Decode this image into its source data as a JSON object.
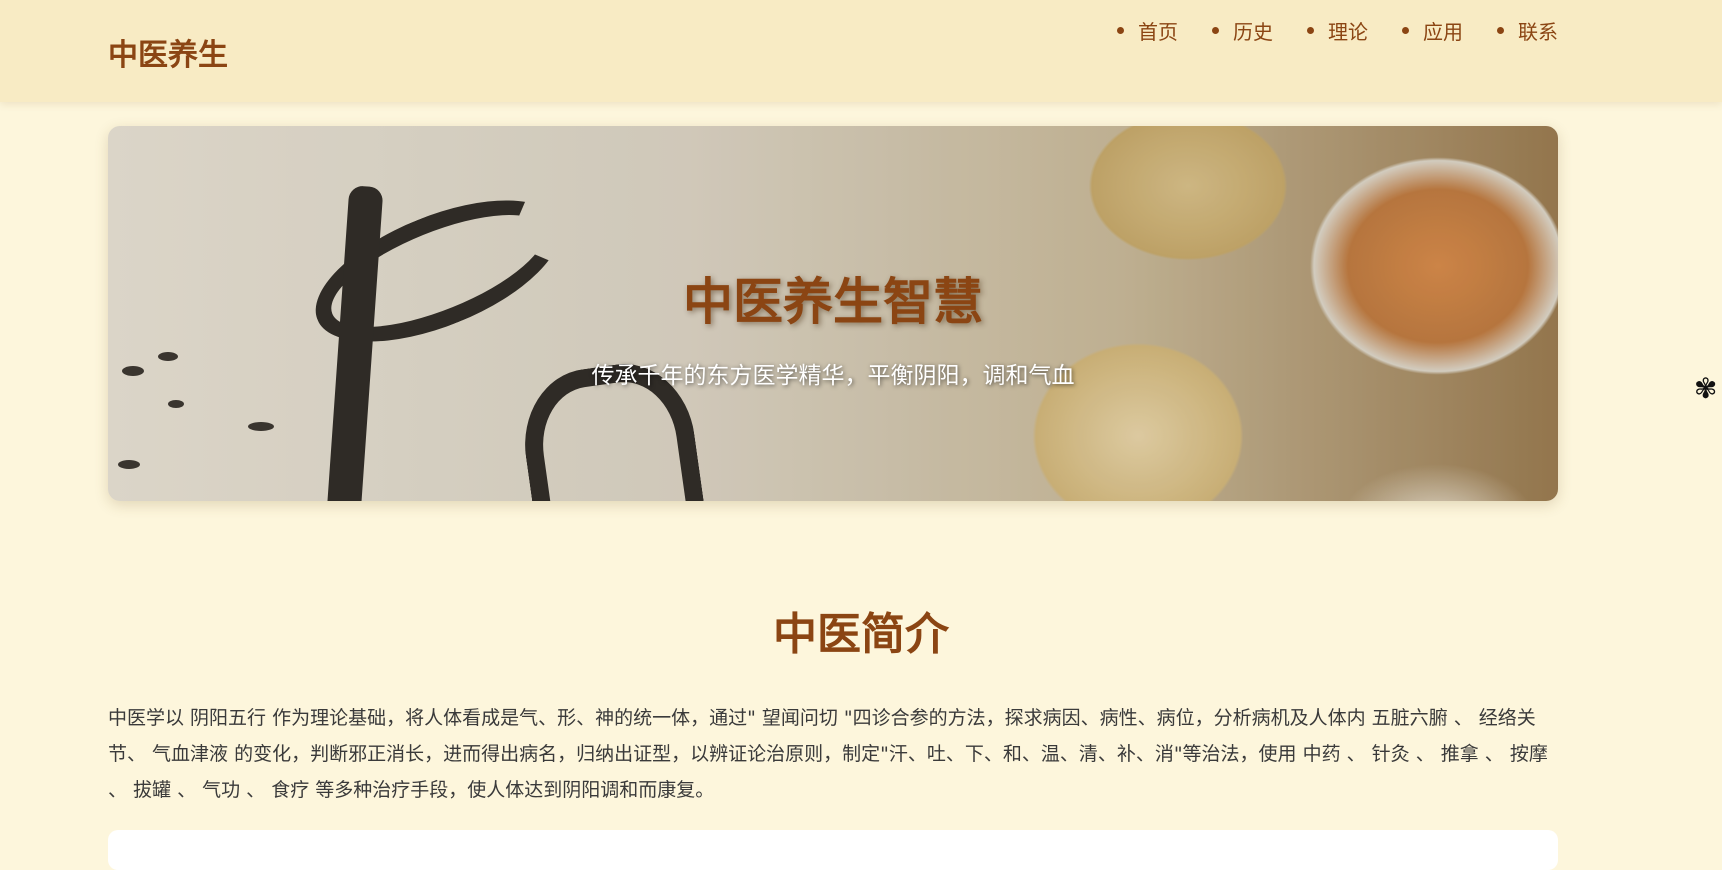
{
  "header": {
    "brand": "中医养生",
    "nav": [
      "首页",
      "历史",
      "理论",
      "应用",
      "联系"
    ]
  },
  "hero": {
    "title": "中医养生智慧",
    "subtitle": "传承千年的东方医学精华，平衡阴阳，调和气血"
  },
  "intro": {
    "title": "中医简介",
    "paragraph": "中医学以 阴阳五行 作为理论基础，将人体看成是气、形、神的统一体，通过\" 望闻问切 \"四诊合参的方法，探求病因、病性、病位，分析病机及人体内 五脏六腑 、 经络关节、 气血津液 的变化，判断邪正消长，进而得出病名，归纳出证型，以辨证论治原则，制定\"汗、吐、下、和、温、清、补、消\"等治法，使用 中药 、 针灸 、 推拿 、 按摩 、 拔罐 、 气功 、 食疗 等多种治疗手段，使人体达到阴阳调和而康复。"
  },
  "icons": {
    "side_widget": "settings-flower-icon"
  },
  "colors": {
    "brand": "#8b4513",
    "background": "#fdf6dc",
    "header_bg": "#f8ebc4"
  }
}
